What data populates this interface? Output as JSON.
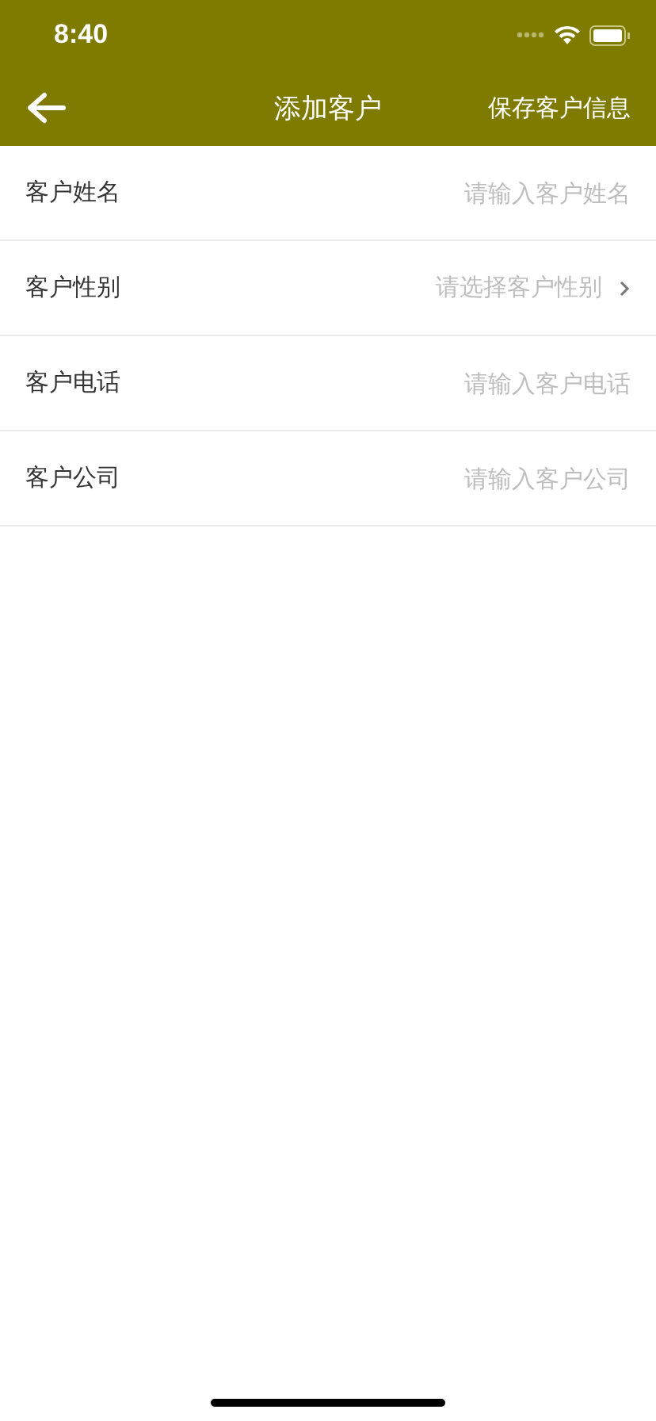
{
  "status_bar": {
    "time": "8:40"
  },
  "nav": {
    "title": "添加客户",
    "action": "保存客户信息"
  },
  "fields": [
    {
      "kind": "input",
      "label": "客户姓名",
      "placeholder": "请输入客户姓名"
    },
    {
      "kind": "select",
      "label": "客户性别",
      "placeholder": "请选择客户性别"
    },
    {
      "kind": "input",
      "label": "客户电话",
      "placeholder": "请输入客户电话"
    },
    {
      "kind": "input",
      "label": "客户公司",
      "placeholder": "请输入客户公司"
    }
  ]
}
